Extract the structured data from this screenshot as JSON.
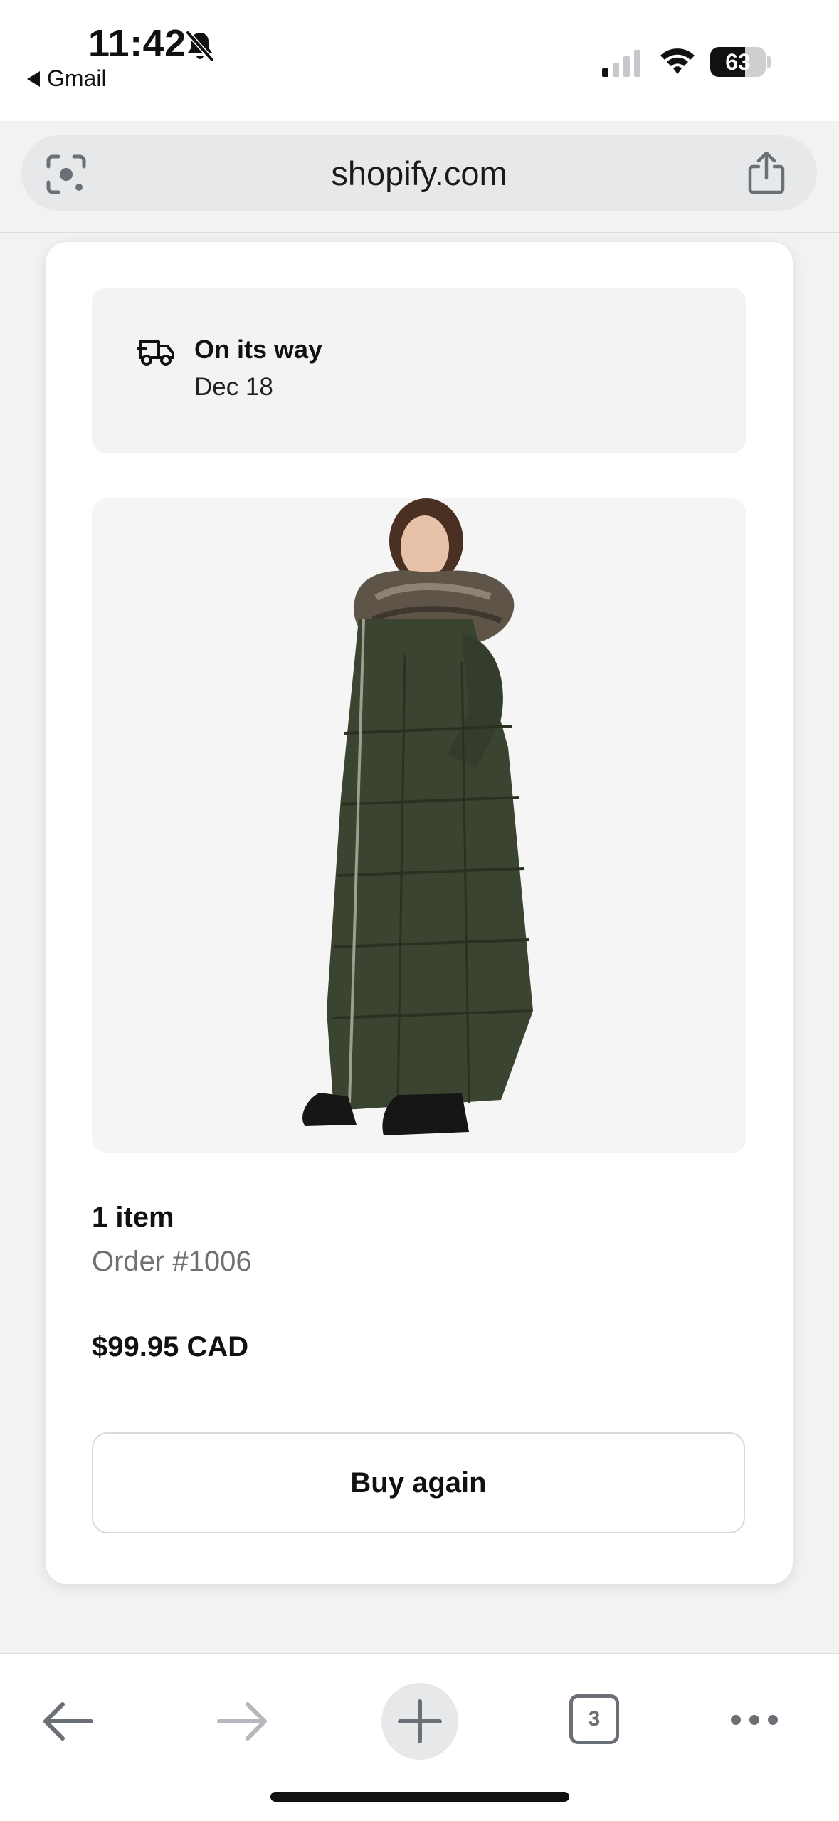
{
  "status_bar": {
    "time": "11:42",
    "back_app": "Gmail",
    "battery": "63",
    "battery_level": 0.63
  },
  "address_bar": {
    "url": "shopify.com"
  },
  "shipment": {
    "status": "On its way",
    "date": "Dec 18"
  },
  "order": {
    "item_count": "1 item",
    "number": "Order #1006",
    "total": "$99.95 CAD",
    "buy_again_label": "Buy again"
  },
  "toolbar": {
    "tab_count": "3"
  },
  "colors": {
    "icon_gray": "#6b7077",
    "disabled_gray": "#b5b8bc",
    "coat_green": "#3b4431"
  }
}
